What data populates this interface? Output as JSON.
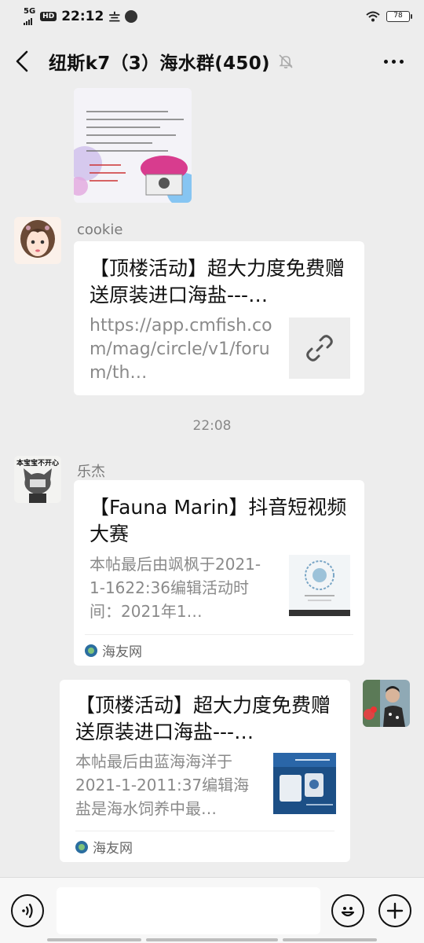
{
  "status_bar": {
    "network": "5G",
    "hd": "HD",
    "time": "22:12",
    "battery": "78"
  },
  "nav": {
    "title": "纽斯k7（3）海水群(450)"
  },
  "messages": {
    "m1": {
      "sender": "cookie",
      "title": "【顶楼活动】超大力度免费赠送原装进口海盐---…",
      "url": "https://app.cmfish.com/mag/circle/v1/forum/th…"
    },
    "timestamp": "22:08",
    "m2": {
      "sender": "乐杰",
      "title": "【Fauna Marin】抖音短视频大赛",
      "desc": "本帖最后由飒枫于2021-1-1622:36编辑活动时间：2021年1…",
      "source": "海友网"
    },
    "m3": {
      "title": "【顶楼活动】超大力度免费赠送原装进口海盐---…",
      "desc": "本帖最后由蓝海海洋于2021-1-2011:37编辑海盐是海水饲养中最…",
      "source": "海友网"
    }
  },
  "icons": {
    "back": "chevron-left-icon",
    "mute": "bell-off-icon",
    "more": "more-dots-icon",
    "link": "link-icon",
    "voice": "voice-icon",
    "emoji": "emoji-icon",
    "add": "plus-icon"
  },
  "colors": {
    "background": "#ededed",
    "bubble": "#ffffff",
    "meta_text": "#888888"
  }
}
